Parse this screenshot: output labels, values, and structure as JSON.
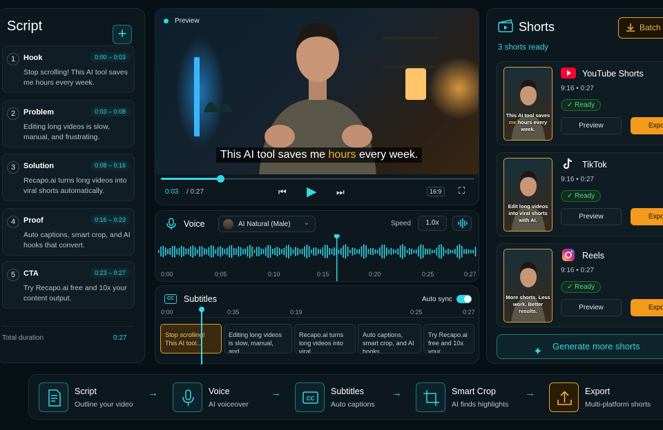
{
  "script": {
    "title": "Script",
    "add_label": "+",
    "segments": [
      {
        "num": "1",
        "name": "Hook",
        "time": "0:00 – 0:03",
        "text": "Stop scrolling! This AI tool saves me hours every week."
      },
      {
        "num": "2",
        "name": "Problem",
        "time": "0:03 – 0:08",
        "text": "Editing long videos is slow, manual, and frustrating."
      },
      {
        "num": "3",
        "name": "Solution",
        "time": "0:08 – 0:16",
        "text": "Recapo.ai turns long videos into viral shorts automatically."
      },
      {
        "num": "4",
        "name": "Proof",
        "time": "0:16 – 0:23",
        "text": "Auto captions, smart crop, and AI hooks that convert."
      },
      {
        "num": "5",
        "name": "CTA",
        "time": "0:23 – 0:27",
        "text": "Try Recapo.ai free and 10x your content output."
      }
    ],
    "total_label": "Total duration",
    "total_value": "0:27"
  },
  "preview": {
    "label": "Preview",
    "caption_pre": "This AI tool saves me ",
    "caption_hl": "hours",
    "caption_post": " every week.",
    "current_time": "0:03",
    "duration": "/ 0:27",
    "progress": 0.19,
    "aspect": "16:9",
    "icons": {
      "prev": "skip-back-icon",
      "play": "play-icon",
      "next": "skip-forward-icon",
      "fullscreen": "fullscreen-icon"
    }
  },
  "voice": {
    "title": "Voice",
    "voice_name": "AI Natural (Male)",
    "speed_label": "Speed",
    "speed_value": "1.0x",
    "ticks": [
      "0:00",
      "0:05",
      "0:10",
      "0:15",
      "0:20",
      "0:25",
      "0:27"
    ],
    "playhead": 0.56
  },
  "subtitles": {
    "title": "Subtitles",
    "cc_label": "CC",
    "autosync_label": "Auto sync",
    "autosync_on": true,
    "ticks": [
      "0:00",
      "0:35",
      "0:19",
      "0:25",
      "0:27"
    ],
    "clips": [
      "Stop scrolling! This AI tool...",
      "Editing long videos is slow, manual, and...",
      "Recapo.ai turns long videos into viral...",
      "Auto captions, smart crop, and AI hooks...",
      "Try Recapo.ai free and 10x your..."
    ]
  },
  "shorts": {
    "title": "Shorts",
    "batch_label": "Batch",
    "ready_text": "3 shorts ready",
    "preview_label": "Preview",
    "export_label": "Export",
    "ready_label": "Ready",
    "items": [
      {
        "platform": "YouTube Shorts",
        "meta": "9:16  •  0:27",
        "cap_pre": "This AI tool saves ",
        "cap_hl": "me",
        "cap_post": " hours every week.",
        "logo": "youtube-logo",
        "color": "#ff0033"
      },
      {
        "platform": "TikTok",
        "meta": "9:16  •  0:27",
        "cap_pre": "Edit long videos into viral shorts with AI.",
        "cap_hl": "",
        "cap_post": "",
        "logo": "tiktok-logo",
        "color": "#ffffff"
      },
      {
        "platform": "Reels",
        "meta": "9:16  •  0:27",
        "cap_pre": "More shorts. Less work. Better results.",
        "cap_hl": "",
        "cap_post": "",
        "logo": "instagram-logo",
        "color": "#d62976"
      }
    ],
    "generate_label": "Generate more shorts"
  },
  "workflow": {
    "steps": [
      {
        "title": "Script",
        "sub": "Outline your video",
        "icon": "document-icon"
      },
      {
        "title": "Voice",
        "sub": "AI voiceover",
        "icon": "microphone-icon"
      },
      {
        "title": "Subtitles",
        "sub": "Auto captions",
        "icon": "cc-icon"
      },
      {
        "title": "Smart Crop",
        "sub": "AI finds highlights",
        "icon": "crop-icon"
      },
      {
        "title": "Export",
        "sub": "Multi-platform shorts",
        "icon": "upload-icon"
      }
    ]
  },
  "colors": {
    "accent": "#34d7e8",
    "orange": "#f29b1d",
    "background": "#071015",
    "ready_green": "#5ed08a"
  }
}
